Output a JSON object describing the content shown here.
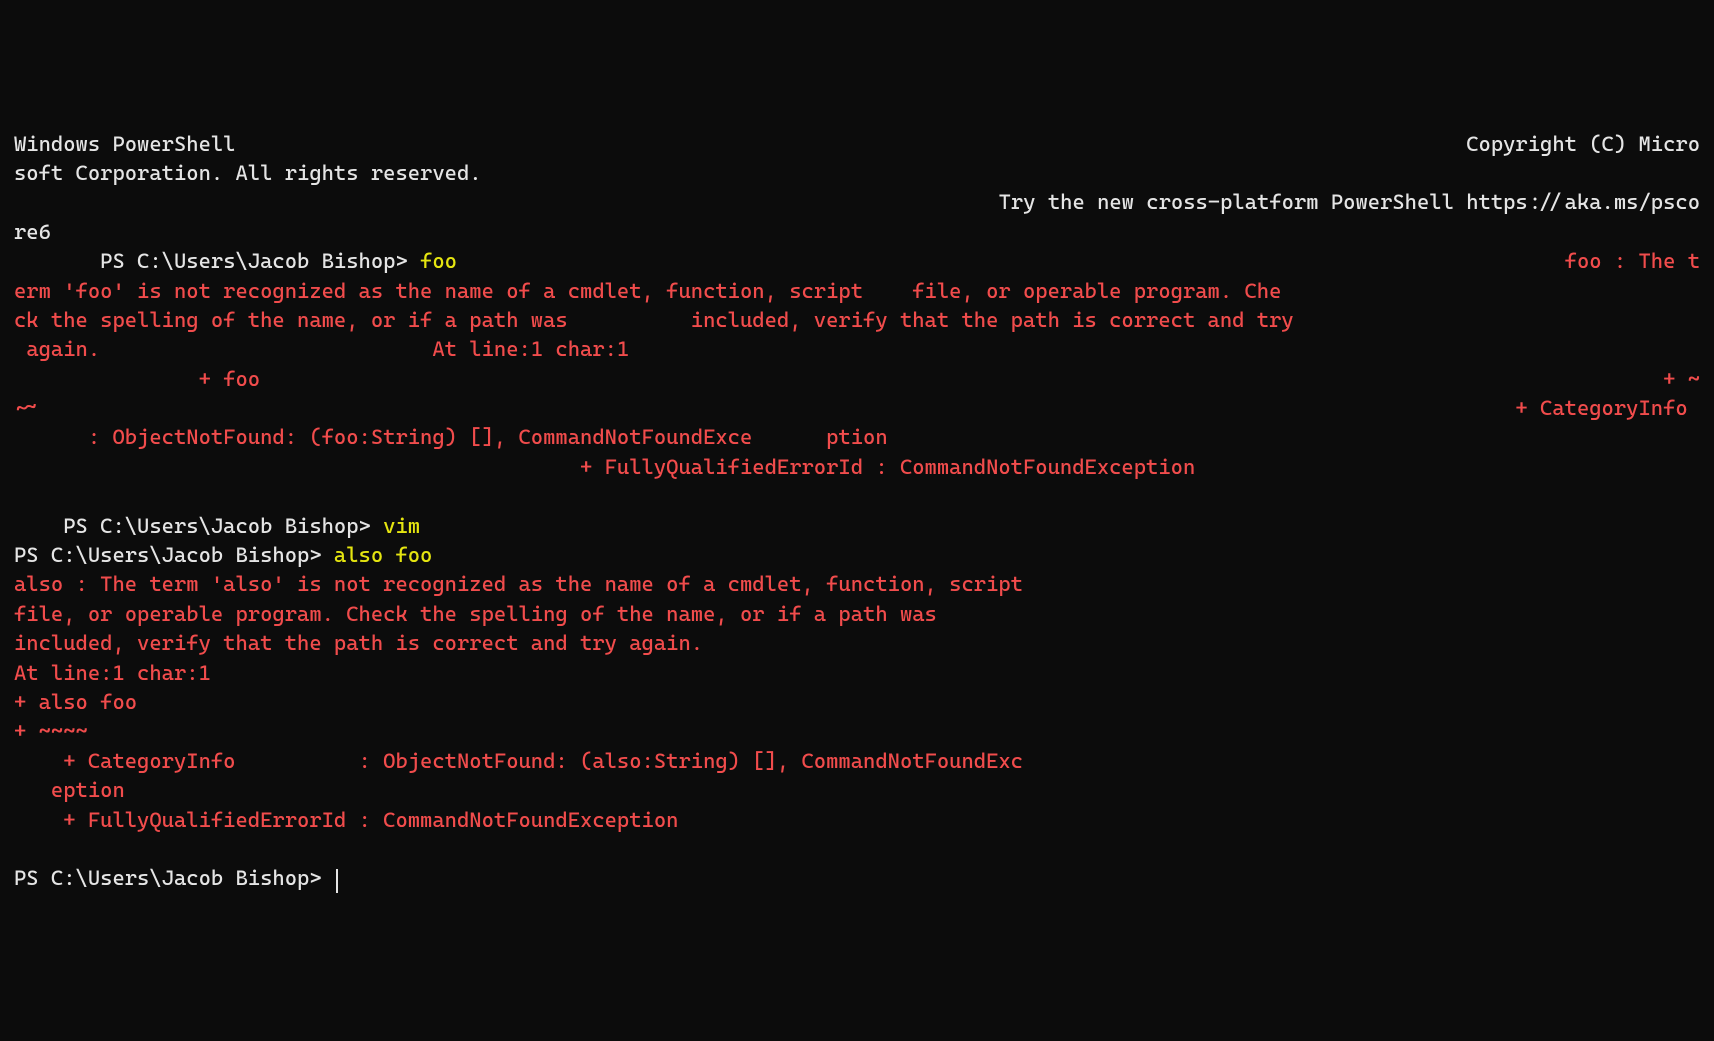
{
  "header": {
    "line1_left": "Windows PowerShell",
    "line1_right": "Copyright (C) Micro",
    "line2": "soft Corporation. All rights reserved.",
    "line3_right": "Try the new cross-platform PowerShell https://aka.ms/psco",
    "line4": "re6"
  },
  "cmd1": {
    "indent": "       ",
    "prompt": "PS C:\\Users\\Jacob Bishop> ",
    "command": "foo",
    "err_tail": "foo : The t"
  },
  "err1": {
    "l1": "erm 'foo' is not recognized as the name of a cmdlet, function, script    file, or operable program. Che",
    "l2": "ck the spelling of the name, or if a path was          included, verify that the path is correct and try",
    "l3a": " again.",
    "l3b": "At line:1 char:1",
    "l4a": "               + foo",
    "l4b": "+ ~",
    "l5a": "~~",
    "l5b": "+ CategoryInfo ",
    "l6": "      : ObjectNotFound: (foo:String) [], CommandNotFoundExce      ption",
    "l7": "                                              + FullyQualifiedErrorId : CommandNotFoundException"
  },
  "cmd2": {
    "indent": "    ",
    "prompt": "PS C:\\Users\\Jacob Bishop> ",
    "command": "vim"
  },
  "cmd3": {
    "prompt": "PS C:\\Users\\Jacob Bishop> ",
    "command": "also foo"
  },
  "err2": {
    "l1": "also : The term 'also' is not recognized as the name of a cmdlet, function, script",
    "l2": "file, or operable program. Check the spelling of the name, or if a path was",
    "l3": "included, verify that the path is correct and try again.",
    "l4": "At line:1 char:1",
    "l5": "+ also foo",
    "l6": "+ ~~~~",
    "l7": "    + CategoryInfo          : ObjectNotFound: (also:String) [], CommandNotFoundExc",
    "l8": "   eption",
    "l9": "    + FullyQualifiedErrorId : CommandNotFoundException"
  },
  "cmd4": {
    "prompt": "PS C:\\Users\\Jacob Bishop> "
  }
}
